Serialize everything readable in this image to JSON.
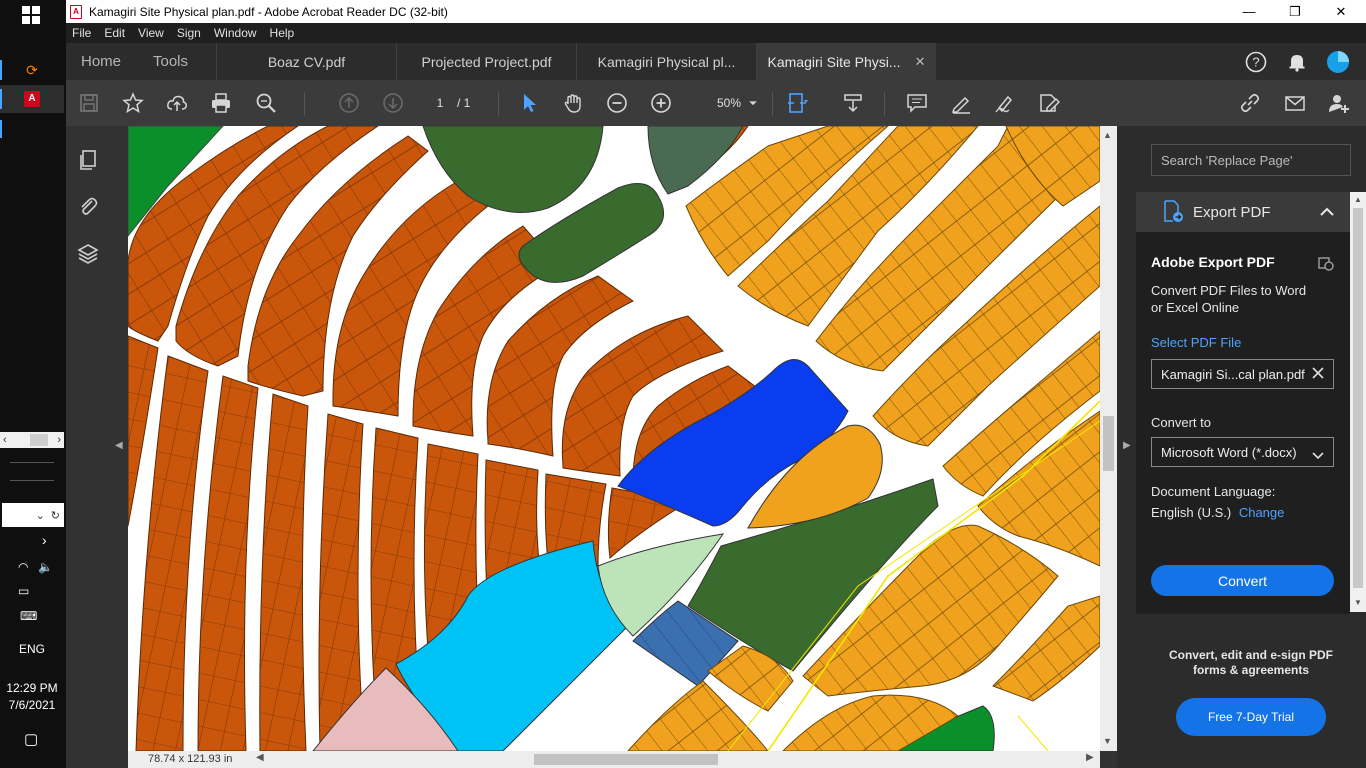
{
  "window": {
    "title": "Kamagiri Site Physical plan.pdf - Adobe Acrobat Reader DC (32-bit)",
    "minimize": "—",
    "restore": "❐",
    "close": "✕"
  },
  "menu": [
    "File",
    "Edit",
    "View",
    "Sign",
    "Window",
    "Help"
  ],
  "tabs": {
    "home": "Home",
    "tools": "Tools",
    "documents": [
      {
        "label": "Boaz  CV.pdf"
      },
      {
        "label": "Projected Project.pdf"
      },
      {
        "label": "Kamagiri Physical pl..."
      },
      {
        "label": "Kamagiri Site Physi...",
        "active": true
      }
    ],
    "close_glyph": "✕"
  },
  "toolbar": {
    "page_current": "1",
    "page_total": "/ 1",
    "zoom": "50%"
  },
  "taskbar": {
    "language": "ENG",
    "time": "12:29 PM",
    "date": "7/6/2021"
  },
  "status": {
    "dimensions": "78.74 x 121.93 in"
  },
  "right_pane": {
    "search_placeholder": "Search 'Replace Page'",
    "export_header": "Export PDF",
    "title": "Adobe Export PDF",
    "subtitle": "Convert PDF Files to Word or Excel Online",
    "select_link": "Select PDF File",
    "file_name": "Kamagiri Si...cal plan.pdf",
    "convert_to_label": "Convert to",
    "convert_to_value": "Microsoft Word (*.docx)",
    "doc_lang_label": "Document Language:",
    "doc_lang_value": "English (U.S.)",
    "change_link": "Change",
    "convert_button": "Convert",
    "promo_text": "Convert, edit and e-sign PDF forms & agreements",
    "trial_button": "Free 7-Day Trial"
  },
  "colors": {
    "residential_brown": "#c9560a",
    "residential_orange": "#f0a21e",
    "green_space": "#3a6b2e",
    "institutional_blue": "#0a3cf0",
    "light_blue": "#00c3f5",
    "pale_green": "#bde3b9",
    "pink": "#e8bcbc",
    "accent_blue": "#1473e6"
  }
}
